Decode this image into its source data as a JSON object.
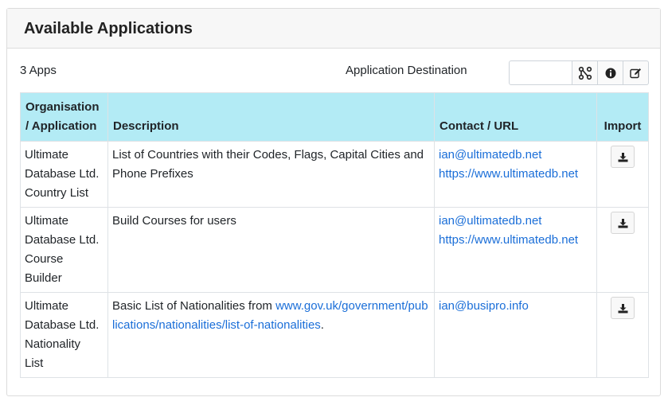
{
  "header": {
    "title": "Available Applications"
  },
  "toolbar": {
    "count_label": "3 Apps",
    "destination_label": "Application Destination",
    "destination_value": ""
  },
  "table": {
    "headers": {
      "org_line1": "Organisation",
      "org_line2": "/ Application",
      "description": "Description",
      "contact": "Contact / URL",
      "import": "Import"
    },
    "rows": [
      {
        "org": [
          "Ultimate",
          "Database Ltd.",
          "Country List"
        ],
        "description": "List of Countries with their Codes, Flags, Capital Cities and Phone Prefixes",
        "email": "ian@ultimatedb.net",
        "url": "https://www.ultimatedb.net"
      },
      {
        "org": [
          "Ultimate",
          "Database Ltd.",
          "Course",
          "Builder"
        ],
        "description": "Build Courses for users",
        "email": "ian@ultimatedb.net",
        "url": "https://www.ultimatedb.net"
      },
      {
        "org": [
          "Ultimate",
          "Database Ltd.",
          "Nationality",
          "List"
        ],
        "description_prefix": "Basic List of Nationalities from",
        "description_link": "www.gov.uk/government/publications/nationalities/list-of-nationalities",
        "description_suffix": ".",
        "email": "ian@busipro.info"
      }
    ]
  },
  "icons": {
    "destination_picker": "sitemap-icon",
    "info": "info-circle-icon",
    "edit": "edit-icon",
    "import": "download-icon"
  }
}
